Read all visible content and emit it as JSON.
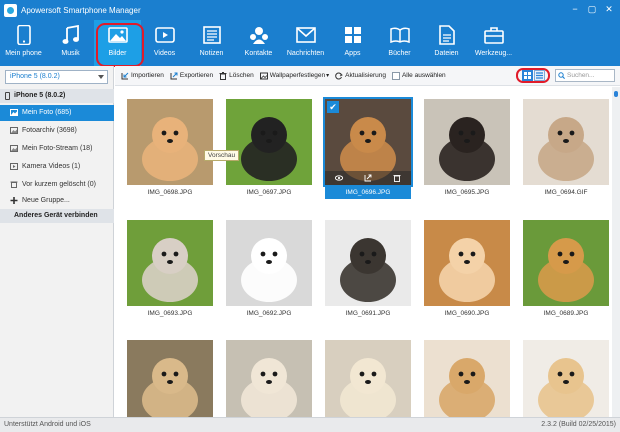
{
  "app": {
    "title": "Apowersoft Smartphone Manager",
    "window_controls": [
      "−",
      "▢",
      "✕"
    ]
  },
  "toolbar": {
    "items": [
      {
        "label": "Mein phone",
        "icon": "phone-icon"
      },
      {
        "label": "Musik",
        "icon": "music-icon"
      },
      {
        "label": "Bilder",
        "icon": "image-icon",
        "active": true
      },
      {
        "label": "Videos",
        "icon": "video-icon"
      },
      {
        "label": "Notizen",
        "icon": "notes-icon"
      },
      {
        "label": "Kontakte",
        "icon": "contacts-icon"
      },
      {
        "label": "Nachrichten",
        "icon": "messages-icon"
      },
      {
        "label": "Apps",
        "icon": "apps-icon"
      },
      {
        "label": "Bücher",
        "icon": "books-icon"
      },
      {
        "label": "Dateien",
        "icon": "files-icon"
      },
      {
        "label": "Werkzeug...",
        "icon": "toolbox-icon"
      }
    ]
  },
  "sidebar": {
    "device_select": "iPhone 5 (8.0.2)",
    "device_header": "iPhone 5 (8.0.2)",
    "items": [
      {
        "label": "Mein Foto (685)",
        "active": true
      },
      {
        "label": "Fotoarchiv (3698)"
      },
      {
        "label": "Mein Foto-Stream (18)"
      },
      {
        "label": "Kamera Videos (1)"
      },
      {
        "label": "Vor kurzem gelöscht (0)"
      },
      {
        "label": "Neue Gruppe..."
      }
    ],
    "other_device": "Anderes Gerät verbinden"
  },
  "actions": {
    "import": "Importieren",
    "export": "Exportieren",
    "delete": "Löschen",
    "wallpaper": "Wallpaperfestlegen",
    "refresh": "Aktualisierung",
    "select_all": "Alle auswählen",
    "search_placeholder": "Suchen..."
  },
  "tooltip": "Vorschau",
  "photos": [
    {
      "name": "IMG_0698.JPG",
      "bg": "#b89a6e",
      "fg": "#e8b27a"
    },
    {
      "name": "IMG_0697.JPG",
      "bg": "#6fa33a",
      "fg": "#222222"
    },
    {
      "name": "IMG_0696.JPG",
      "bg": "#5a4a3e",
      "fg": "#c98a4a",
      "selected": true
    },
    {
      "name": "IMG_0695.JPG",
      "bg": "#c9c3b8",
      "fg": "#2a2320"
    },
    {
      "name": "IMG_0694.GIF",
      "bg": "#e4dcd2",
      "fg": "#c7a888"
    },
    {
      "name": "IMG_0693.JPG",
      "bg": "#6f9e3a",
      "fg": "#d8cfc5"
    },
    {
      "name": "IMG_0692.JPG",
      "bg": "#d9d9d9",
      "fg": "#ffffff"
    },
    {
      "name": "IMG_0691.JPG",
      "bg": "#eaeaea",
      "fg": "#3b3631"
    },
    {
      "name": "IMG_0690.JPG",
      "bg": "#c88a48",
      "fg": "#f4d2a8"
    },
    {
      "name": "IMG_0689.JPG",
      "bg": "#6a9a3a",
      "fg": "#d69a4a"
    },
    {
      "name": "",
      "bg": "#8a7a5e",
      "fg": "#d9b98a"
    },
    {
      "name": "",
      "bg": "#c6c0b3",
      "fg": "#f0e6d6"
    },
    {
      "name": "",
      "bg": "#d8cfbf",
      "fg": "#f2e7d2"
    },
    {
      "name": "",
      "bg": "#ece0d0",
      "fg": "#d9a86a"
    },
    {
      "name": "",
      "bg": "#f0ece6",
      "fg": "#e8c48e"
    }
  ],
  "status": {
    "left": "Unterstützt Android und iOS",
    "right": "2.3.2 (Build 02/25/2015)"
  },
  "colors": {
    "brand_blue": "#1b7fcf",
    "selection_blue": "#1b8ad8",
    "highlight_red": "#e01b2a"
  }
}
